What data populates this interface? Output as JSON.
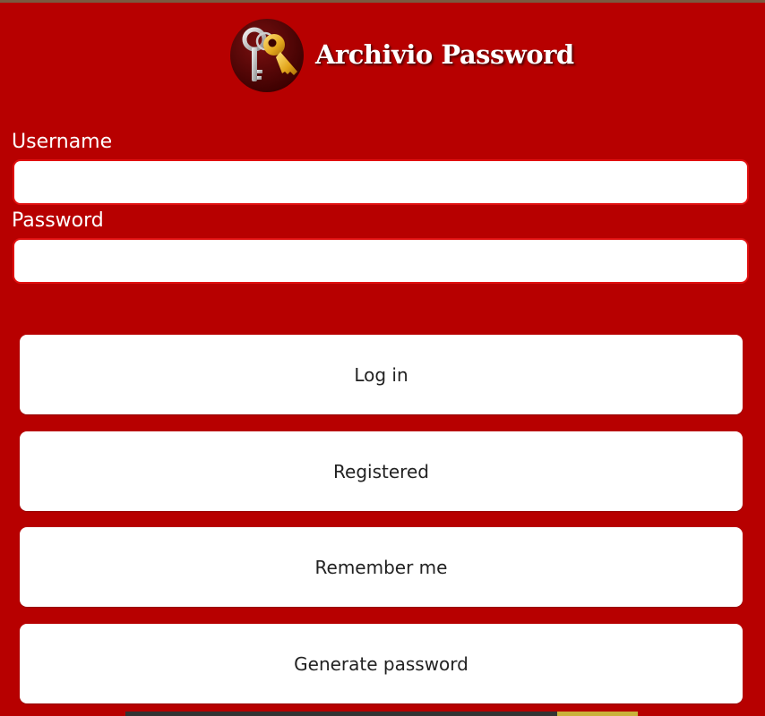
{
  "app": {
    "title": "Archivio Password",
    "logo_icon": "keys-icon",
    "background_color": "#b70000"
  },
  "form": {
    "username_label": "Username",
    "username_value": "",
    "password_label": "Password",
    "password_value": ""
  },
  "buttons": {
    "login": "Log in",
    "registered": "Registered",
    "remember": "Remember me",
    "generate": "Generate password"
  }
}
